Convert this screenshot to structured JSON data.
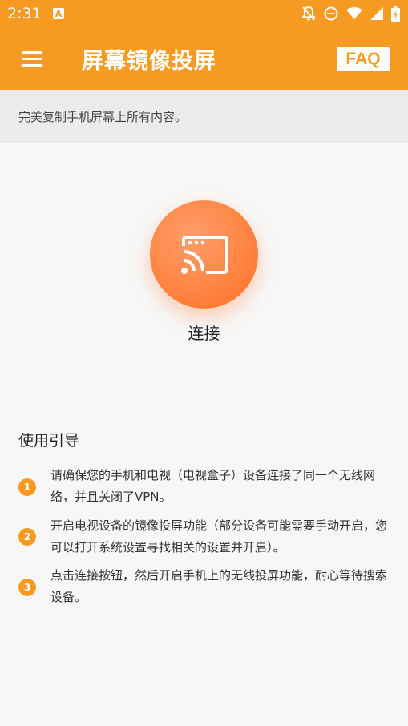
{
  "status_bar": {
    "time": "2:31",
    "a_icon": "A",
    "icons": [
      "notifications-off-icon",
      "do-not-disturb-icon",
      "wifi-icon",
      "cellular-signal-icon",
      "battery-charging-icon"
    ]
  },
  "app_bar": {
    "title": "屏幕镜像投屏",
    "faq_label": "FAQ",
    "menu_icon": "menu-icon"
  },
  "subtitle": "完美复制手机屏幕上所有内容。",
  "connect": {
    "icon": "cast-icon",
    "label": "连接"
  },
  "guide": {
    "title": "使用引导",
    "items": [
      {
        "num": "1",
        "text": "请确保您的手机和电视（电视盒子）设备连接了同一个无线网络，并且关闭了VPN。"
      },
      {
        "num": "2",
        "text": "开启电视设备的镜像投屏功能（部分设备可能需要手动开启，您可以打开系统设置寻找相关的设置并开启）。"
      },
      {
        "num": "3",
        "text": "点击连接按钮，然后开启手机上的无线投屏功能，耐心等待搜索设备。"
      }
    ]
  },
  "colors": {
    "accent": "#f79a22",
    "connect_gradient_start": "#ff9d6c",
    "connect_gradient_end": "#ff6f24"
  }
}
